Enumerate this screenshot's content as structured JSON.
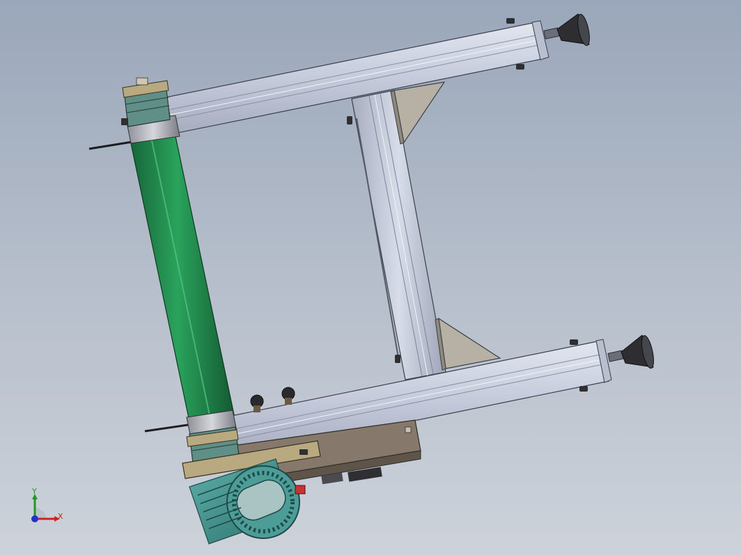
{
  "viewport": {
    "background_top": "#9aa7ba",
    "background_bottom": "#cdd2da"
  },
  "model": {
    "roller_color": "#1f8a4a",
    "frame_color": "#c4cad9",
    "motor_color": "#3d8e8a",
    "foot_color": "#2e2e2e",
    "plate_color": "#8a7a68"
  },
  "triad": {
    "x_label": "X",
    "y_label": "Y",
    "x_color": "#cc2222",
    "y_color": "#229922",
    "z_color": "#2233cc"
  }
}
